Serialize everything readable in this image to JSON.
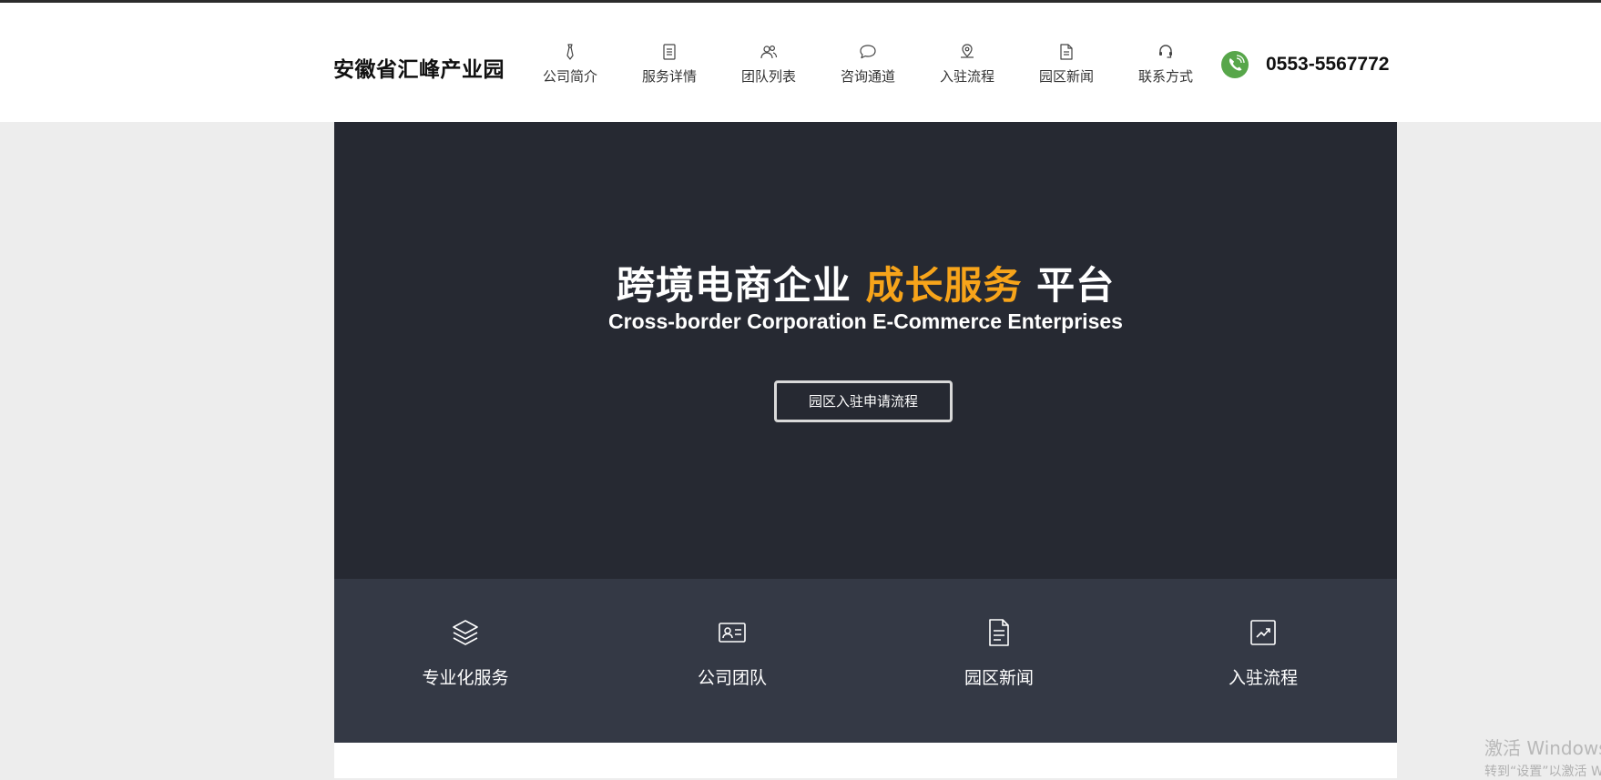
{
  "header": {
    "logo": "安徽省汇峰产业园",
    "nav": [
      {
        "label": "公司简介",
        "icon": "tie-icon"
      },
      {
        "label": "服务详情",
        "icon": "list-document-icon"
      },
      {
        "label": "团队列表",
        "icon": "users-icon"
      },
      {
        "label": "咨询通道",
        "icon": "chat-bubble-icon"
      },
      {
        "label": "入驻流程",
        "icon": "pin-icon"
      },
      {
        "label": "园区新闻",
        "icon": "news-document-icon"
      },
      {
        "label": "联系方式",
        "icon": "headset-icon"
      }
    ],
    "phone": {
      "number": "0553-5567772",
      "icon": "phone-icon",
      "badge_color": "#57a64a"
    }
  },
  "hero": {
    "title_part1": "跨境电商企业 ",
    "title_accent": "成长服务",
    "title_part2": " 平台",
    "subtitle": "Cross-border Corporation E-Commerce Enterprises",
    "button_label": "园区入驻申请流程",
    "accent_color": "#f7a41a",
    "background_color": "#262932"
  },
  "features": [
    {
      "label": "专业化服务",
      "icon": "layers-icon"
    },
    {
      "label": "公司团队",
      "icon": "id-card-icon"
    },
    {
      "label": "园区新闻",
      "icon": "document-icon"
    },
    {
      "label": "入驻流程",
      "icon": "trend-chart-icon"
    }
  ],
  "watermark": {
    "title": "激活 Windows",
    "subtitle": "转到“设置”以激活 Windows。"
  }
}
